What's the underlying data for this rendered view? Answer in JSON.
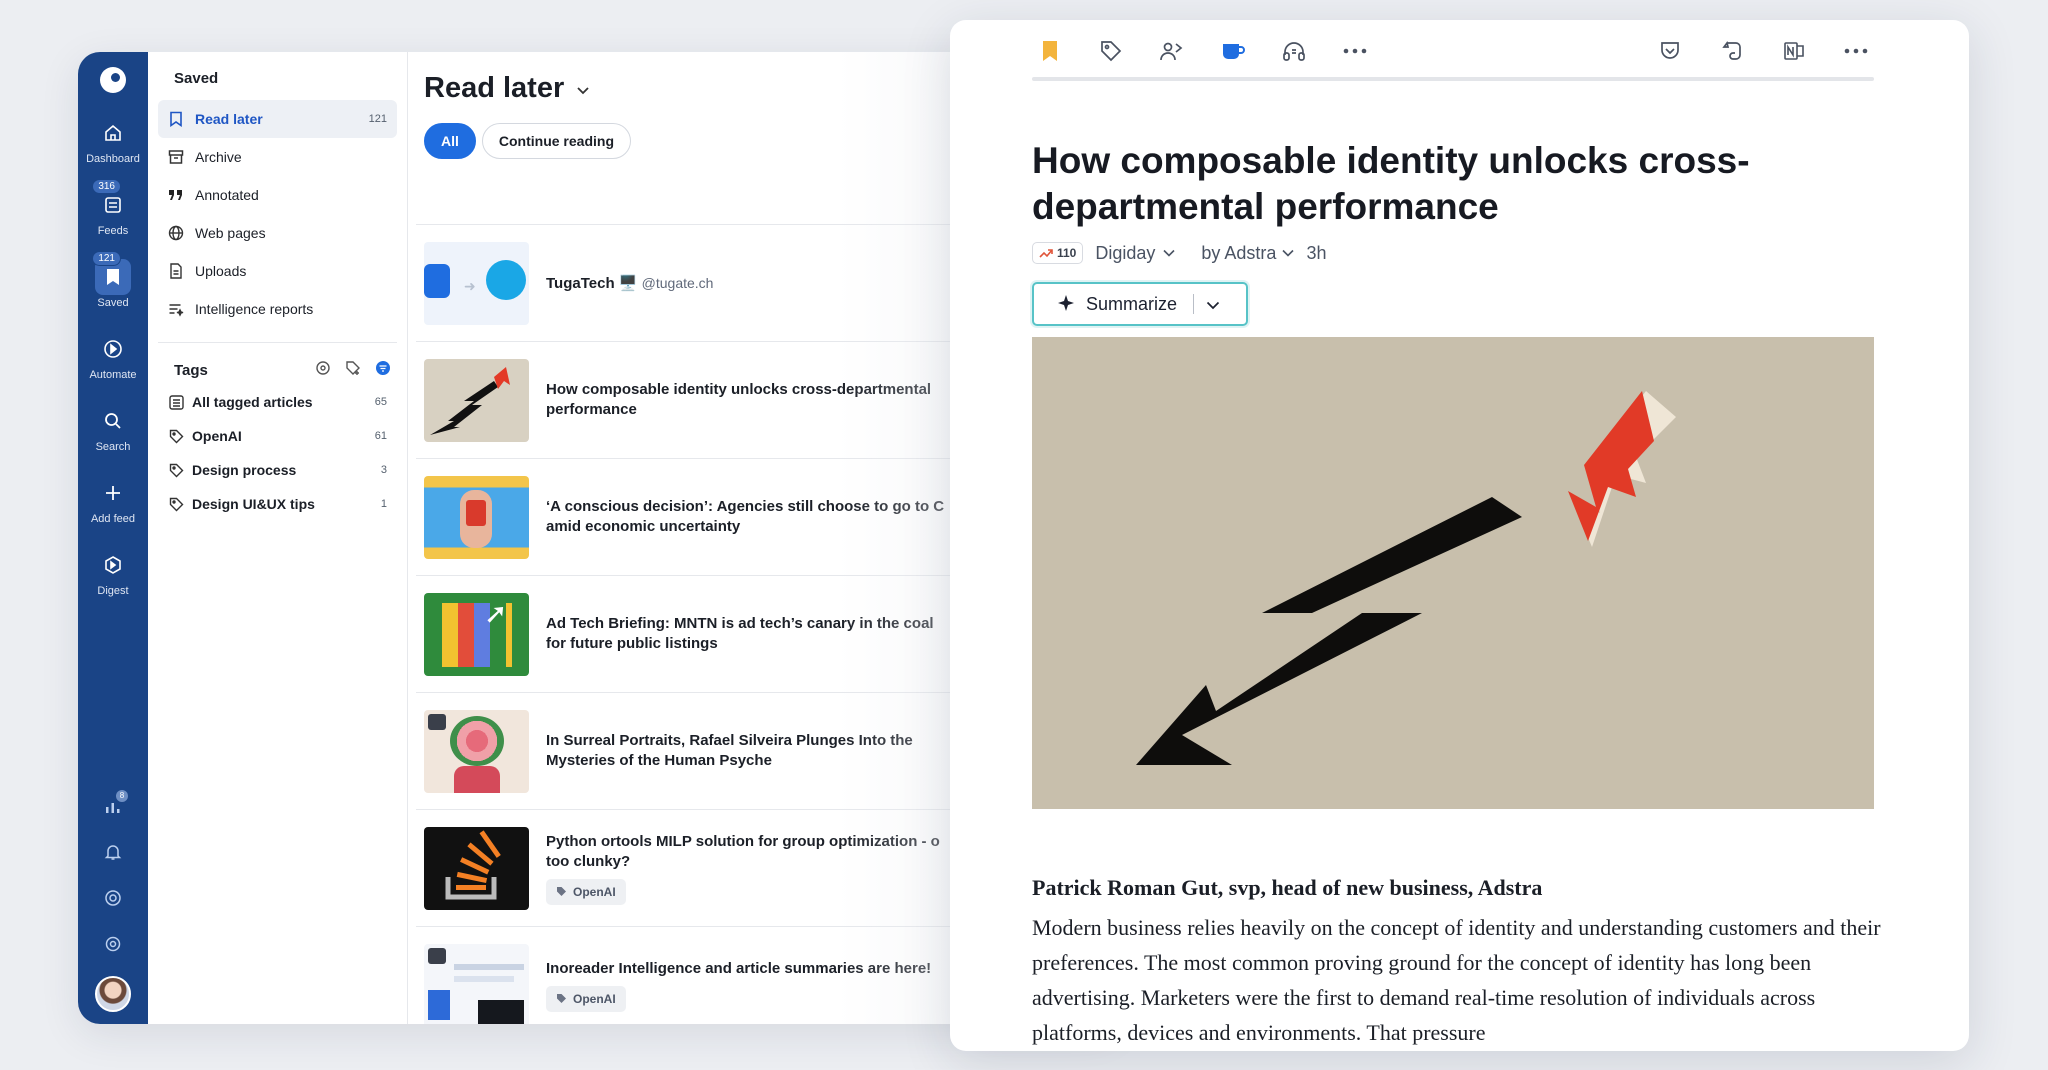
{
  "rail": {
    "items": [
      {
        "label": "Dashboard"
      },
      {
        "label": "Feeds",
        "badge": "316"
      },
      {
        "label": "Saved",
        "badge": "121"
      },
      {
        "label": "Automate"
      },
      {
        "label": "Search"
      },
      {
        "label": "Add feed"
      },
      {
        "label": "Digest"
      }
    ],
    "stats_badge": "8"
  },
  "nav": {
    "header": "Saved",
    "items": [
      {
        "label": "Read later",
        "count": "121",
        "icon": "bookmark-icon"
      },
      {
        "label": "Archive",
        "count": "",
        "icon": "archive-icon"
      },
      {
        "label": "Annotated",
        "count": "",
        "icon": "quote-icon"
      },
      {
        "label": "Web pages",
        "count": "",
        "icon": "globe-icon"
      },
      {
        "label": "Uploads",
        "count": "",
        "icon": "document-icon"
      },
      {
        "label": "Intelligence reports",
        "count": "",
        "icon": "report-icon"
      }
    ],
    "tags_header": "Tags",
    "tags": [
      {
        "label": "All tagged articles",
        "count": "65"
      },
      {
        "label": "OpenAI",
        "count": "61"
      },
      {
        "label": "Design process",
        "count": "3"
      },
      {
        "label": "Design UI&UX tips",
        "count": "1"
      }
    ]
  },
  "list": {
    "title": "Read later",
    "chips": [
      "All",
      "Continue reading"
    ],
    "articles": [
      {
        "title": "TugaTech 🖥️",
        "handle": "@tugate.ch",
        "tag": ""
      },
      {
        "title": "How composable identity unlocks cross-departmental",
        "title2": "performance",
        "tag": ""
      },
      {
        "title": "‘A conscious decision’: Agencies still choose to go to C",
        "title2": "amid economic uncertainty",
        "tag": ""
      },
      {
        "title": "Ad Tech Briefing: MNTN is ad tech’s canary in the coal",
        "title2": "for future public listings",
        "tag": ""
      },
      {
        "title": "In Surreal Portraits, Rafael Silveira Plunges Into the",
        "title2": "Mysteries of the Human Psyche",
        "tag": ""
      },
      {
        "title": "Python ortools MILP solution for group optimization - o",
        "title2": "too clunky?",
        "tag": "OpenAI"
      },
      {
        "title": "Inoreader Intelligence and article summaries are here!",
        "title2": "",
        "tag": "OpenAI"
      }
    ]
  },
  "reader": {
    "title": "How composable identity unlocks cross-departmental performance",
    "trend": "110",
    "source": "Digiday",
    "author": "by Adstra",
    "age": "3h",
    "summarize": "Summarize",
    "byline": "Patrick Roman Gut, svp, head of new business, Adstra",
    "body": "Modern business relies heavily on the concept of identity and understanding customers and their preferences. The most common proving ground for the concept of identity has long been advertising. Marketers were the first to demand real-time resolution of individuals across platforms, devices and environments. That pressure",
    "progress": 0,
    "colors": {
      "accent": "#1f6de0",
      "rail": "#1a4486",
      "bookmark": "#f3b43c",
      "summarize_border": "#57c3c7"
    }
  }
}
